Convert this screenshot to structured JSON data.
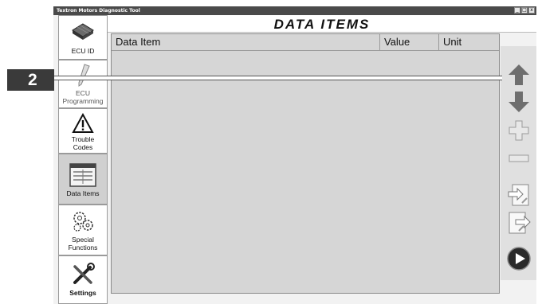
{
  "window": {
    "title": "Textron Motors Diagnostic Tool",
    "controls": [
      "_",
      "□",
      "x"
    ]
  },
  "header": {
    "title": "DATA ITEMS"
  },
  "nav": {
    "items": [
      {
        "label": "ECU ID",
        "icon": "chip-icon"
      },
      {
        "label": "ECU Programming",
        "icon": "pen-icon"
      },
      {
        "label": "Trouble Codes",
        "icon": "warning-icon"
      },
      {
        "label": "Data Items",
        "icon": "data-list-icon"
      },
      {
        "label": "Special Functions",
        "icon": "gears-icon"
      },
      {
        "label": "Settings",
        "icon": "tools-icon"
      }
    ]
  },
  "table": {
    "columns": [
      "Data Item",
      "Value",
      "Unit"
    ],
    "rows": []
  },
  "toolbar": {
    "buttons": [
      "up-arrow-icon",
      "down-arrow-icon",
      "plus-icon",
      "minus-icon",
      "import-icon",
      "export-icon",
      "play-icon"
    ]
  },
  "callout": {
    "number": "2"
  },
  "colors": {
    "table_bg": "#d6d6d6",
    "arrow_gray": "#6e6e6e",
    "title_bar": "#4a4a4a"
  }
}
